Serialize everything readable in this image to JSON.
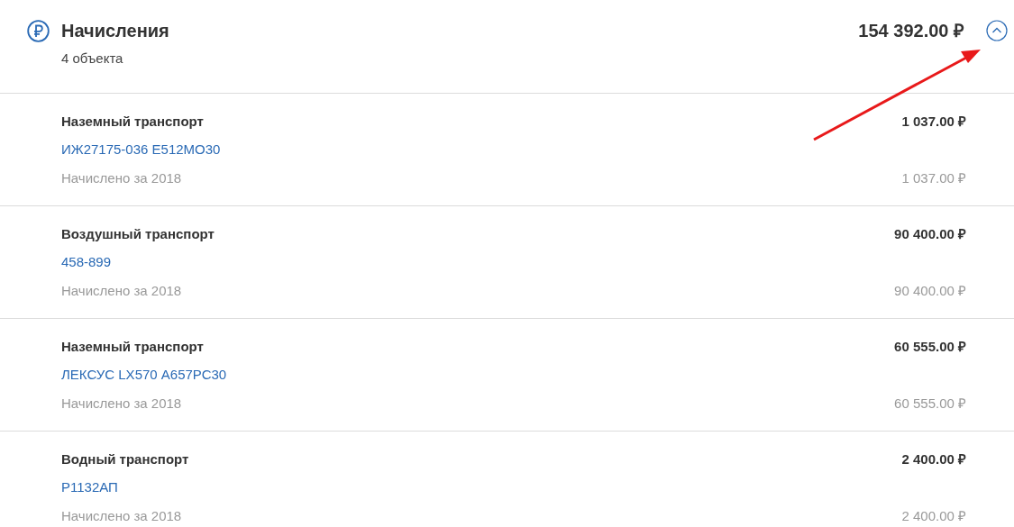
{
  "header": {
    "title": "Начисления",
    "subtitle": "4 объекта",
    "total": "154 392.00 ₽",
    "expanded": true
  },
  "items": [
    {
      "category": "Наземный транспорт",
      "object": "ИЖ27175-036 Е512МО30",
      "description": "Начислено за 2018",
      "amount": "1 037.00 ₽",
      "accrued": "1 037.00 ₽"
    },
    {
      "category": "Воздушный транспорт",
      "object": "458-899",
      "description": "Начислено за 2018",
      "amount": "90 400.00 ₽",
      "accrued": "90 400.00 ₽"
    },
    {
      "category": "Наземный транспорт",
      "object": "ЛЕКСУС LX570 А657РС30",
      "description": "Начислено за 2018",
      "amount": "60 555.00 ₽",
      "accrued": "60 555.00 ₽"
    },
    {
      "category": "Водный транспорт",
      "object": "Р1132АП",
      "description": "Начислено за 2018",
      "amount": "2 400.00 ₽",
      "accrued": "2 400.00 ₽"
    }
  ]
}
